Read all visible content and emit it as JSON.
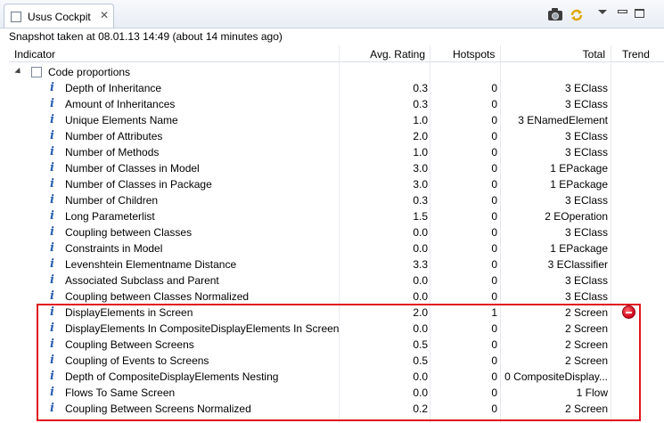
{
  "window": {
    "tab_title": "Usus Cockpit",
    "tab_icon": "view-icon",
    "close_icon": "close-icon",
    "snapshot_text": "Snapshot taken at 08.01.13 14:49 (about 14 minutes ago)"
  },
  "toolbar": {
    "icons": [
      "camera-icon",
      "refresh-icon",
      "view-menu-icon",
      "minimize-icon",
      "maximize-icon"
    ],
    "accent_yellow": "#f0c020"
  },
  "table": {
    "headers": {
      "indicator": "Indicator",
      "avg_rating": "Avg. Rating",
      "hotspots": "Hotspots",
      "total": "Total",
      "trend": "Trend"
    },
    "group": {
      "label": "Code proportions",
      "expanded": true
    },
    "rows": [
      {
        "name": "Depth of Inheritance",
        "avg": "0.3",
        "hotspots": "0",
        "total": "3 EClass"
      },
      {
        "name": "Amount of Inheritances",
        "avg": "0.3",
        "hotspots": "0",
        "total": "3 EClass"
      },
      {
        "name": "Unique Elements Name",
        "avg": "1.0",
        "hotspots": "0",
        "total": "3 ENamedElement"
      },
      {
        "name": "Number of Attributes",
        "avg": "2.0",
        "hotspots": "0",
        "total": "3 EClass"
      },
      {
        "name": "Number of Methods",
        "avg": "1.0",
        "hotspots": "0",
        "total": "3 EClass"
      },
      {
        "name": "Number of Classes in Model",
        "avg": "3.0",
        "hotspots": "0",
        "total": "1 EPackage"
      },
      {
        "name": "Number of Classes in Package",
        "avg": "3.0",
        "hotspots": "0",
        "total": "1 EPackage"
      },
      {
        "name": "Number of Children",
        "avg": "0.3",
        "hotspots": "0",
        "total": "3 EClass"
      },
      {
        "name": "Long Parameterlist",
        "avg": "1.5",
        "hotspots": "0",
        "total": "2 EOperation"
      },
      {
        "name": "Coupling between Classes",
        "avg": "0.0",
        "hotspots": "0",
        "total": "3 EClass"
      },
      {
        "name": "Constraints in Model",
        "avg": "0.0",
        "hotspots": "0",
        "total": "1 EPackage"
      },
      {
        "name": "Levenshtein Elementname Distance",
        "avg": "3.3",
        "hotspots": "0",
        "total": "3 EClassifier"
      },
      {
        "name": "Associated Subclass and Parent",
        "avg": "0.0",
        "hotspots": "0",
        "total": "3 EClass"
      },
      {
        "name": "Coupling between Classes Normalized",
        "avg": "0.0",
        "hotspots": "0",
        "total": "3 EClass"
      },
      {
        "name": "DisplayElements in Screen",
        "avg": "2.0",
        "hotspots": "1",
        "total": "2 Screen",
        "trend": "error-icon"
      },
      {
        "name": "DisplayElements In CompositeDisplayElements In Screen",
        "avg": "0.0",
        "hotspots": "0",
        "total": "2 Screen"
      },
      {
        "name": "Coupling Between Screens",
        "avg": "0.5",
        "hotspots": "0",
        "total": "2 Screen"
      },
      {
        "name": "Coupling of Events to Screens",
        "avg": "0.5",
        "hotspots": "0",
        "total": "2 Screen"
      },
      {
        "name": "Depth of CompositeDisplayElements Nesting",
        "avg": "0.0",
        "hotspots": "0",
        "total": "0 CompositeDisplay..."
      },
      {
        "name": "Flows To Same Screen",
        "avg": "0.0",
        "hotspots": "0",
        "total": "1 Flow"
      },
      {
        "name": "Coupling Between Screens Normalized",
        "avg": "0.2",
        "hotspots": "0",
        "total": "2 Screen"
      }
    ]
  },
  "colors": {
    "highlight_border": "#e0161e",
    "info_icon": "#2a5fb0",
    "error_icon": "#d0001a"
  }
}
